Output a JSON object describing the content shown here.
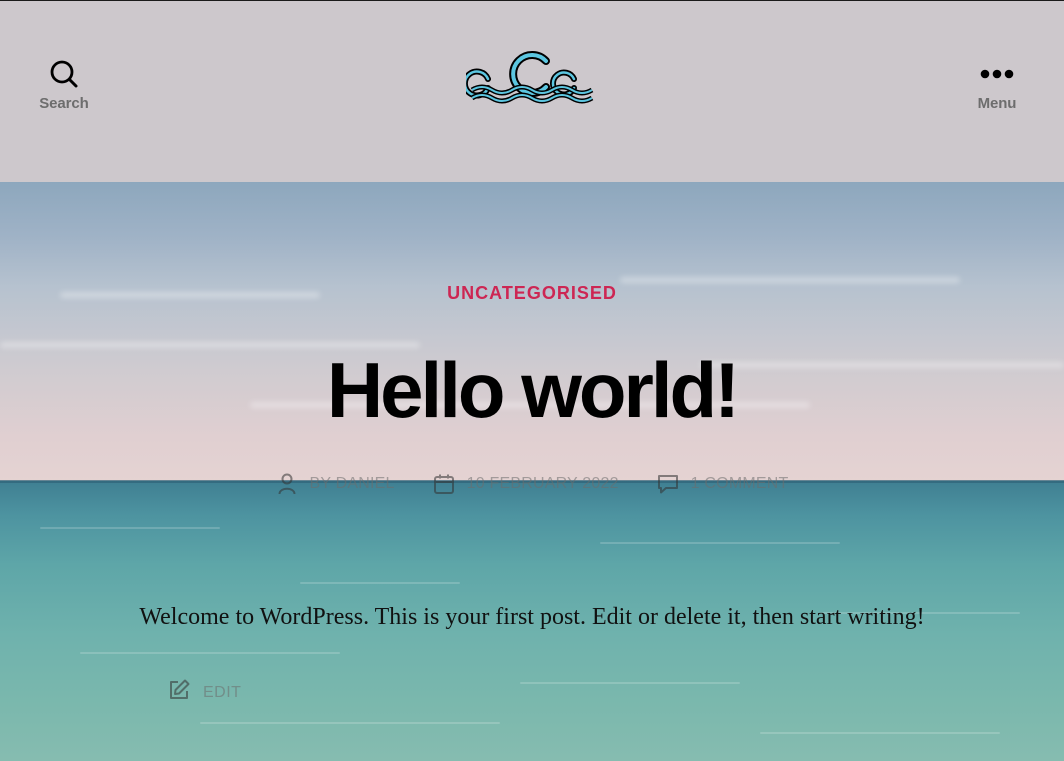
{
  "header": {
    "search_label": "Search",
    "menu_label": "Menu",
    "logo_icon": "waves-logo-icon",
    "search_icon": "search-icon",
    "menu_icon": "more-horizontal-icon"
  },
  "post": {
    "category": "Uncategorised",
    "title": "Hello world!",
    "meta": {
      "author_prefix": "By",
      "author": "Daniel",
      "date": "10 February 2022",
      "comments": "1 Comment"
    },
    "body": "Welcome to WordPress. This is your first post. Edit or delete it, then start writing!",
    "edit_label": "Edit"
  },
  "colors": {
    "accent": "#cd2653",
    "header_bg": "#cdc8cc",
    "text": "#000000",
    "muted": "#6d6d6d",
    "logo_teal": "#5cc6e0"
  }
}
